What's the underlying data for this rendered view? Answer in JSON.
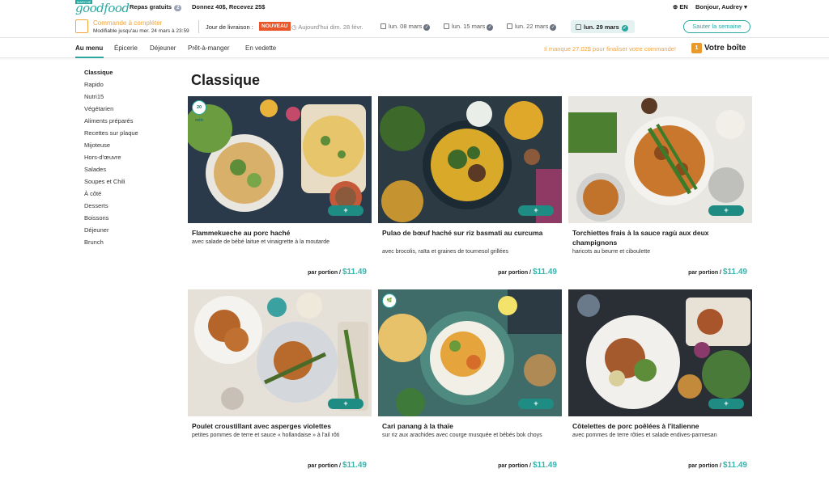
{
  "brand": {
    "badge": "MARCHÉ",
    "wordmark": "goodfood"
  },
  "topbar": {
    "free_meals": "Repas gratuits",
    "free_meals_count": "2",
    "referral": "Donnez 40$, Recevez 25$",
    "language": "EN",
    "greeting": "Bonjour, Audrey"
  },
  "order": {
    "title": "Commande à compléter",
    "subtitle": "Modifiable jusqu'au mer. 24 mars à 23:59"
  },
  "delivery": {
    "label": "Jour de livraison :",
    "new_badge": "NOUVEAU",
    "today": "Aujourd'hui dim. 28 févr.",
    "dates": [
      "lun. 08 mars",
      "lun. 15 mars",
      "lun. 22 mars"
    ],
    "active_date": "lun. 29 mars",
    "skip_button": "Sauter la semaine"
  },
  "nav": {
    "tabs": [
      "Au menu",
      "Épicerie",
      "Déjeuner",
      "Prêt-à-manger",
      "En vedette"
    ],
    "missing_notice": "Il manque 27.02$ pour finaliser votre commande!",
    "box_count": "1",
    "box_label": "Votre boîte"
  },
  "sidebar": {
    "items": [
      "Classique",
      "Rapido",
      "Nutri15",
      "Végétarien",
      "Aliments préparés",
      "Recettes sur plaque",
      "Mijoteuse",
      "Hors-d'œuvre",
      "Salades",
      "Soupes et Chili",
      "À côté",
      "Desserts",
      "Boissons",
      "Déjeuner",
      "Brunch"
    ]
  },
  "section_title": "Classique",
  "price_label": "par portion /",
  "add_label": "+",
  "cards": [
    {
      "name": "Flammekueche au porc haché",
      "sub": "avec salade de bébé laitue et vinaigrette à la moutarde",
      "price": "$11.49",
      "badge": "20 min"
    },
    {
      "name": "Pulao de bœuf haché sur riz basmati au curcuma",
      "sub": "avec brocolis, raïta et graines de tournesol grillées",
      "price": "$11.49"
    },
    {
      "name": "Torchiettes frais à la sauce ragù aux deux champignons",
      "sub": "haricots au beurre et ciboulette",
      "price": "$11.49"
    },
    {
      "name": "Poulet croustillant avec asperges violettes",
      "sub": "petites pommes de terre et sauce « hollandaise » à l'ail rôti",
      "price": "$11.49"
    },
    {
      "name": "Cari panang à la thaïe",
      "sub": "sur riz aux arachides avec courge musquée et bébés bok choys",
      "price": "$11.49",
      "badge": "🌿"
    },
    {
      "name": "Côtelettes de porc poêlées à l'italienne",
      "sub": "avec pommes de terre rôties et salade endives-parmesan",
      "price": "$11.49"
    }
  ],
  "colors": {
    "brand": "#2aa7a0",
    "accent_orange": "#f2a33a",
    "badge_red": "#e8562a"
  }
}
